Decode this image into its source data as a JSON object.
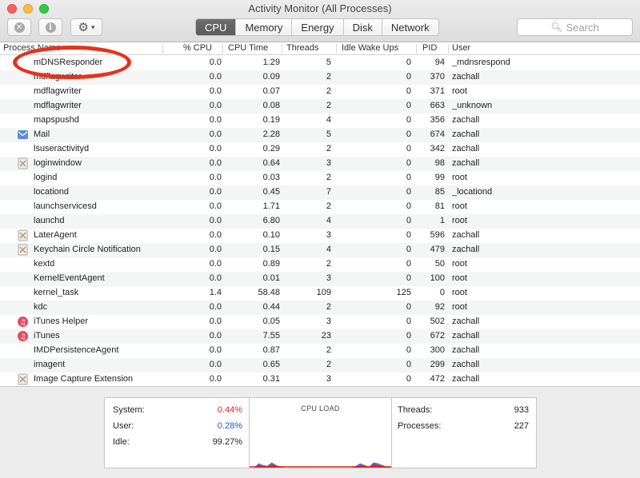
{
  "window": {
    "title": "Activity Monitor (All Processes)"
  },
  "toolbar": {
    "stop_icon": "x-circle-icon",
    "info_icon": "info-icon",
    "action_icon": "gear-icon",
    "tabs": [
      "CPU",
      "Memory",
      "Energy",
      "Disk",
      "Network"
    ],
    "active_tab": "CPU",
    "search_placeholder": "Search"
  },
  "table": {
    "columns": [
      "Process Name",
      "% CPU",
      "CPU Time",
      "Threads",
      "Idle Wake Ups",
      "PID",
      "User"
    ],
    "rows": [
      {
        "name": "mDNSResponder",
        "cpu": "0.0",
        "time": "1.29",
        "threads": "5",
        "idle": "0",
        "pid": "94",
        "user": "_mdnsrespond",
        "icon": ""
      },
      {
        "name": "mdflagwriter",
        "cpu": "0.0",
        "time": "0.09",
        "threads": "2",
        "idle": "0",
        "pid": "370",
        "user": "zachall",
        "icon": ""
      },
      {
        "name": "mdflagwriter",
        "cpu": "0.0",
        "time": "0.07",
        "threads": "2",
        "idle": "0",
        "pid": "371",
        "user": "root",
        "icon": ""
      },
      {
        "name": "mdflagwriter",
        "cpu": "0.0",
        "time": "0.08",
        "threads": "2",
        "idle": "0",
        "pid": "663",
        "user": "_unknown",
        "icon": ""
      },
      {
        "name": "mapspushd",
        "cpu": "0.0",
        "time": "0.19",
        "threads": "4",
        "idle": "0",
        "pid": "356",
        "user": "zachall",
        "icon": ""
      },
      {
        "name": "Mail",
        "cpu": "0.0",
        "time": "2.28",
        "threads": "5",
        "idle": "0",
        "pid": "674",
        "user": "zachall",
        "icon": "mail-icon"
      },
      {
        "name": "lsuseractivityd",
        "cpu": "0.0",
        "time": "0.29",
        "threads": "2",
        "idle": "0",
        "pid": "342",
        "user": "zachall",
        "icon": ""
      },
      {
        "name": "loginwindow",
        "cpu": "0.0",
        "time": "0.64",
        "threads": "3",
        "idle": "0",
        "pid": "98",
        "user": "zachall",
        "icon": "generic-app-icon"
      },
      {
        "name": "logind",
        "cpu": "0.0",
        "time": "0.03",
        "threads": "2",
        "idle": "0",
        "pid": "99",
        "user": "root",
        "icon": ""
      },
      {
        "name": "locationd",
        "cpu": "0.0",
        "time": "0.45",
        "threads": "7",
        "idle": "0",
        "pid": "85",
        "user": "_locationd",
        "icon": ""
      },
      {
        "name": "launchservicesd",
        "cpu": "0.0",
        "time": "1.71",
        "threads": "2",
        "idle": "0",
        "pid": "81",
        "user": "root",
        "icon": ""
      },
      {
        "name": "launchd",
        "cpu": "0.0",
        "time": "6.80",
        "threads": "4",
        "idle": "0",
        "pid": "1",
        "user": "root",
        "icon": ""
      },
      {
        "name": "LaterAgent",
        "cpu": "0.0",
        "time": "0.10",
        "threads": "3",
        "idle": "0",
        "pid": "596",
        "user": "zachall",
        "icon": "generic-app-icon"
      },
      {
        "name": "Keychain Circle Notification",
        "cpu": "0.0",
        "time": "0.15",
        "threads": "4",
        "idle": "0",
        "pid": "479",
        "user": "zachall",
        "icon": "generic-app-icon"
      },
      {
        "name": "kextd",
        "cpu": "0.0",
        "time": "0.89",
        "threads": "2",
        "idle": "0",
        "pid": "50",
        "user": "root",
        "icon": ""
      },
      {
        "name": "KernelEventAgent",
        "cpu": "0.0",
        "time": "0.01",
        "threads": "3",
        "idle": "0",
        "pid": "100",
        "user": "root",
        "icon": ""
      },
      {
        "name": "kernel_task",
        "cpu": "1.4",
        "time": "58.48",
        "threads": "109",
        "idle": "125",
        "pid": "0",
        "user": "root",
        "icon": ""
      },
      {
        "name": "kdc",
        "cpu": "0.0",
        "time": "0.44",
        "threads": "2",
        "idle": "0",
        "pid": "92",
        "user": "root",
        "icon": ""
      },
      {
        "name": "iTunes Helper",
        "cpu": "0.0",
        "time": "0.05",
        "threads": "3",
        "idle": "0",
        "pid": "502",
        "user": "zachall",
        "icon": "itunes-icon"
      },
      {
        "name": "iTunes",
        "cpu": "0.0",
        "time": "7.55",
        "threads": "23",
        "idle": "0",
        "pid": "672",
        "user": "zachall",
        "icon": "itunes-icon"
      },
      {
        "name": "IMDPersistenceAgent",
        "cpu": "0.0",
        "time": "0.87",
        "threads": "2",
        "idle": "0",
        "pid": "300",
        "user": "zachall",
        "icon": ""
      },
      {
        "name": "imagent",
        "cpu": "0.0",
        "time": "0.65",
        "threads": "2",
        "idle": "0",
        "pid": "299",
        "user": "zachall",
        "icon": ""
      },
      {
        "name": "Image Capture Extension",
        "cpu": "0.0",
        "time": "0.31",
        "threads": "3",
        "idle": "0",
        "pid": "472",
        "user": "zachall",
        "icon": "generic-app-icon"
      }
    ]
  },
  "summary": {
    "system_label": "System:",
    "system_value": "0.44%",
    "user_label": "User:",
    "user_value": "0.28%",
    "idle_label": "Idle:",
    "idle_value": "99.27%",
    "cpu_load_label": "CPU LOAD",
    "threads_label": "Threads:",
    "threads_value": "933",
    "processes_label": "Processes:",
    "processes_value": "227",
    "colors": {
      "system": "#e0251b",
      "user": "#2a4bd7"
    },
    "cpu_load_history": {
      "system": [
        0.0,
        0.0,
        0.15,
        0.1,
        0.05,
        0.2,
        0.1,
        0.05,
        0.0,
        0.0,
        0.0,
        0.0,
        0.0,
        0.0,
        0.0,
        0.0,
        0.0,
        0.0,
        0.0,
        0.0,
        0.0,
        0.0,
        0.0,
        0.0,
        0.05,
        0.15,
        0.1,
        0.05,
        0.2,
        0.15,
        0.1,
        0.05,
        0.0
      ],
      "user": [
        0.0,
        0.0,
        0.1,
        0.05,
        0.05,
        0.1,
        0.05,
        0.0,
        0.0,
        0.0,
        0.0,
        0.0,
        0.0,
        0.0,
        0.0,
        0.0,
        0.0,
        0.0,
        0.0,
        0.0,
        0.0,
        0.0,
        0.0,
        0.0,
        0.05,
        0.1,
        0.05,
        0.0,
        0.1,
        0.1,
        0.05,
        0.0,
        0.0
      ]
    }
  }
}
